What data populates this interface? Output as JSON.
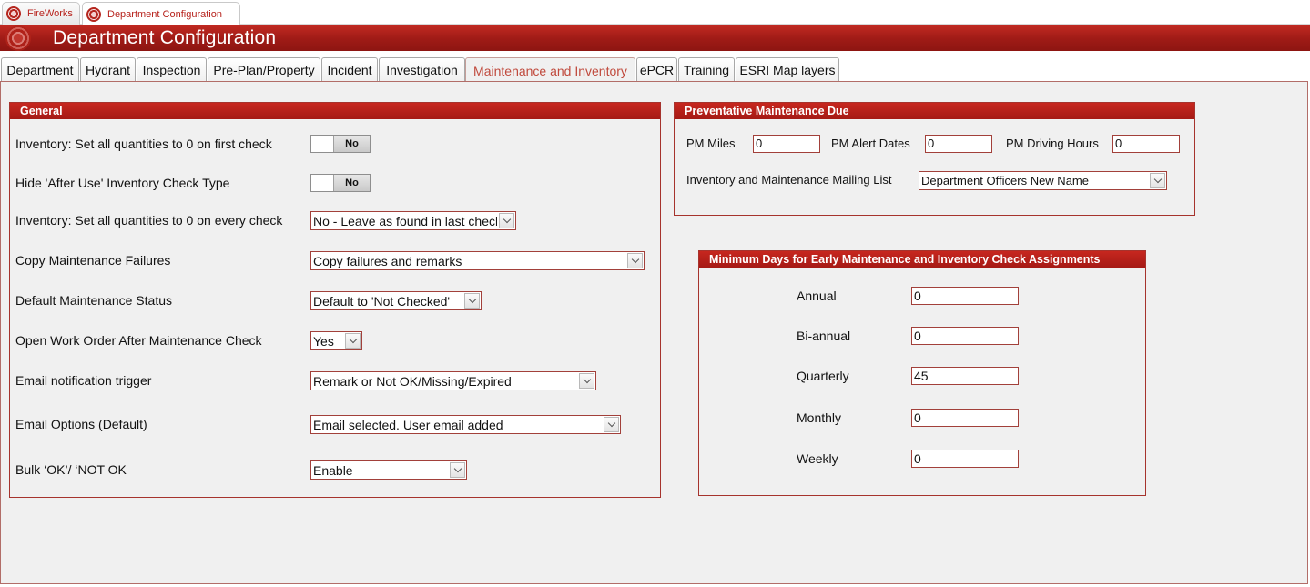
{
  "doc_tabs": [
    {
      "label": "FireWorks"
    },
    {
      "label": "Department Configuration"
    }
  ],
  "window_title": "Department Configuration",
  "form_tabs": [
    {
      "label": "Department"
    },
    {
      "label": "Hydrant"
    },
    {
      "label": "Inspection"
    },
    {
      "label": "Pre-Plan/Property"
    },
    {
      "label": "Incident"
    },
    {
      "label": "Investigation"
    },
    {
      "label": "Maintenance and Inventory"
    },
    {
      "label": "ePCR"
    },
    {
      "label": "Training"
    },
    {
      "label": "ESRI Map layers"
    }
  ],
  "active_tab": "Maintenance and Inventory",
  "general": {
    "title": "General",
    "zero_first_check": {
      "label": "Inventory: Set all quantities to 0 on first check",
      "value": "No"
    },
    "hide_after_use": {
      "label": "Hide 'After Use' Inventory Check Type",
      "value": "No"
    },
    "zero_every_check": {
      "label": "Inventory: Set all quantities to 0 on every check",
      "value": "No - Leave as found in last check"
    },
    "copy_failures": {
      "label": "Copy Maintenance Failures",
      "value": "Copy failures and remarks"
    },
    "default_status": {
      "label": "Default Maintenance Status",
      "value": "Default to 'Not Checked'"
    },
    "open_work_order": {
      "label": "Open Work Order After Maintenance Check",
      "value": "Yes"
    },
    "email_trigger": {
      "label": "Email notification trigger",
      "value": "Remark or Not OK/Missing/Expired"
    },
    "email_options": {
      "label": "Email Options (Default)",
      "value": "Email selected. User email added"
    },
    "bulk_ok": {
      "label": "Bulk ‘OK’/ ‘NOT OK",
      "value": "Enable"
    }
  },
  "pm_due": {
    "title": "Preventative Maintenance Due",
    "miles": {
      "label": "PM Miles",
      "value": "0"
    },
    "alert_dates": {
      "label": "PM Alert Dates",
      "value": "0"
    },
    "driving_hours": {
      "label": "PM Driving Hours",
      "value": "0"
    },
    "mailing_list": {
      "label": "Inventory and Maintenance Mailing List",
      "value": "Department Officers New Name"
    }
  },
  "min_days": {
    "title": "Minimum Days for Early Maintenance and Inventory Check Assignments",
    "annual": {
      "label": "Annual",
      "value": "0"
    },
    "biannual": {
      "label": "Bi-annual",
      "value": "0"
    },
    "quarterly": {
      "label": "Quarterly",
      "value": "45"
    },
    "monthly": {
      "label": "Monthly",
      "value": "0"
    },
    "weekly": {
      "label": "Weekly",
      "value": "0"
    }
  },
  "colors": {
    "brand_red": "#b3211b",
    "active_tab_text": "#c04a3d",
    "panel_bg": "#f0f0f0"
  }
}
